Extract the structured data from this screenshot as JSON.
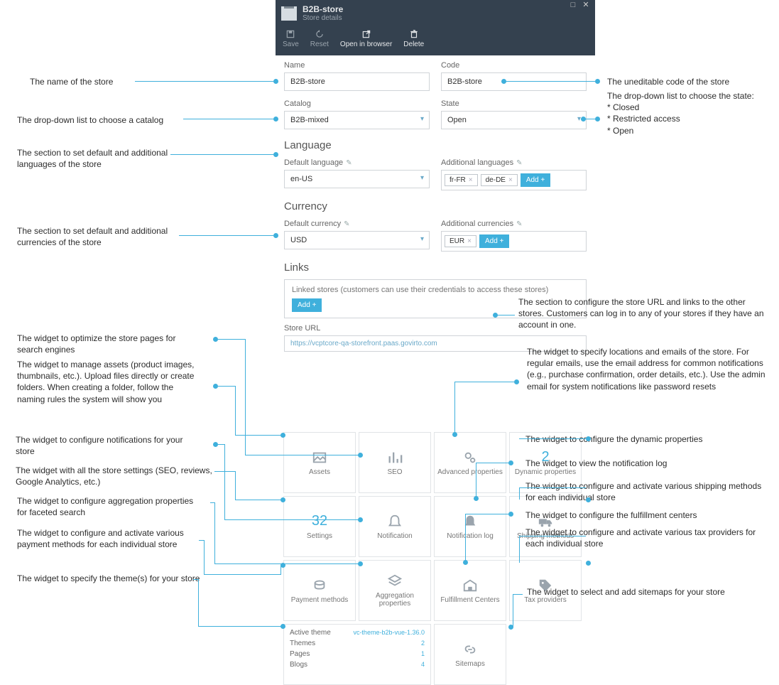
{
  "window": {
    "title": "B2B-store",
    "subtitle": "Store details",
    "toolbar": {
      "save": "Save",
      "reset": "Reset",
      "open": "Open in browser",
      "delete": "Delete"
    }
  },
  "fields": {
    "name_label": "Name",
    "name_value": "B2B-store",
    "code_label": "Code",
    "code_value": "B2B-store",
    "catalog_label": "Catalog",
    "catalog_value": "B2B-mixed",
    "state_label": "State",
    "state_value": "Open"
  },
  "language": {
    "heading": "Language",
    "default_label": "Default language",
    "default_value": "en-US",
    "additional_label": "Additional languages",
    "chips": [
      "fr-FR",
      "de-DE"
    ],
    "add": "Add +"
  },
  "currency": {
    "heading": "Currency",
    "default_label": "Default currency",
    "default_value": "USD",
    "additional_label": "Additional currencies",
    "chips": [
      "EUR"
    ],
    "add": "Add +"
  },
  "links": {
    "heading": "Links",
    "linked_label": "Linked stores (customers can use their credentials to access these stores)",
    "add": "Add +",
    "url_label": "Store URL",
    "url_value": "https://vcptcore-qa-storefront.paas.govirto.com"
  },
  "widgets": {
    "assets": "Assets",
    "seo": "SEO",
    "advprops": "Advanced properties",
    "dynprops_count": "2",
    "dynprops": "Dynamic properties",
    "settings_count": "32",
    "settings": "Settings",
    "notification": "Notification",
    "notiflog": "Notification log",
    "shipping": "Shipping methods",
    "payment": "Payment methods",
    "aggregation": "Aggregation properties",
    "fulfillment": "Fulfillment Centers",
    "tax": "Tax providers",
    "theme_active": "Active theme",
    "theme_active_val": "vc-theme-b2b-vue-1.36.0",
    "theme_themes": "Themes",
    "theme_themes_val": "2",
    "theme_pages": "Pages",
    "theme_pages_val": "1",
    "theme_blogs": "Blogs",
    "theme_blogs_val": "4",
    "sitemaps": "Sitemaps"
  },
  "annotations": {
    "name": "The name of the store",
    "code": "The uneditable code of the store",
    "catalog": "The drop-down list to choose a catalog",
    "state": "The drop-down list to choose the state:\n* Closed\n* Restricted access\n* Open",
    "language": "The section to set default and additional languages of the store",
    "currency": "The section to set default and additional currencies of the store",
    "links": "The section to configure the store URL and links to the other stores. Customers can log in to any of your stores if they have an account in one.",
    "seo": "The widget to optimize the store pages for search engines",
    "assets": "The widget to manage assets (product images, thumbnails, etc.). Upload files directly or create folders. When creating a folder, follow the naming rules the system will show you",
    "advprops": "The widget to specify locations and emails of the store. For regular emails, use the email address for common notifications (e.g., purchase confirmation, order details, etc.). Use the admin email for system notifications like password resets",
    "dynprops": "The widget to configure the dynamic properties",
    "notification": "The widget to configure notifications for your store",
    "settings": "The widget with all the store settings (SEO, reviews, Google Analytics, etc.)",
    "notiflog": "The widget to view the notification log",
    "shipping": "The widget to configure and activate various shipping methods for each individual store",
    "aggregation": "The widget to configure aggregation properties for faceted search",
    "fulfillment": "The widget to configure the fulfillment centers",
    "payment": "The widget to configure and activate various payment methods for each individual store",
    "tax": "The widget to configure and activate various tax providers for each individual store",
    "theme": "The widget to specify the theme(s) for your store",
    "sitemaps": "The widget to select and add sitemaps for your store"
  }
}
